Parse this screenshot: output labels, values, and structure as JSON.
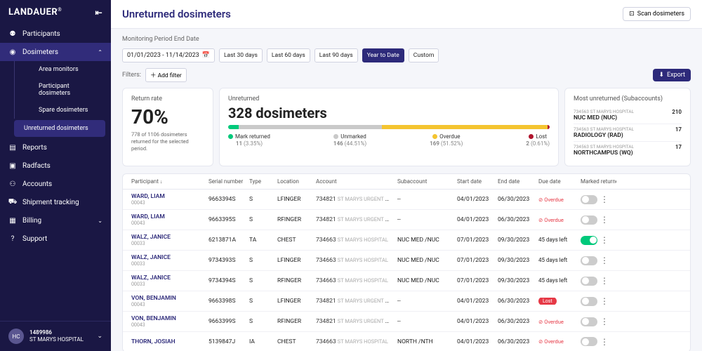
{
  "brand": "LANDAUER",
  "brand_suffix": "®",
  "page_title": "Unreturned dosimeters",
  "scan_label": "Scan dosimeters",
  "sidebar": {
    "items": [
      {
        "icon": "users",
        "label": "Participants"
      },
      {
        "icon": "dosimeter",
        "label": "Dosimeters",
        "expanded": true
      },
      {
        "icon": "report",
        "label": "Reports"
      },
      {
        "icon": "radfacts",
        "label": "Radfacts"
      },
      {
        "icon": "accounts",
        "label": "Accounts"
      },
      {
        "icon": "ship",
        "label": "Shipment tracking"
      },
      {
        "icon": "billing",
        "label": "Billing"
      },
      {
        "icon": "support",
        "label": "Support"
      }
    ],
    "sub": [
      "Area monitors",
      "Participant dosimeters",
      "Spare dosimeters",
      "Unreturned dosimeters"
    ]
  },
  "user": {
    "initials": "HC",
    "id": "1489986",
    "org": "ST MARYS HOSPITAL"
  },
  "period": {
    "label": "Monitoring Period End Date",
    "range": "01/01/2023 - 11/14/2023",
    "presets": [
      "Last 30 days",
      "Last 60 days",
      "Last 90 days",
      "Year to Date",
      "Custom"
    ],
    "active": 3
  },
  "filters": {
    "label": "Filters:",
    "add": "Add filter"
  },
  "export_label": "Export",
  "return_rate": {
    "title": "Return rate",
    "pct": "70%",
    "sub": "778 of 1106 dosimeters returned for the selected period."
  },
  "unreturned": {
    "title": "Unreturned",
    "count": "328 dosimeters",
    "segments": [
      {
        "name": "Mark returned",
        "value": "11",
        "pct": "(3.35%)",
        "color": "#00c97b"
      },
      {
        "name": "Unmarked",
        "value": "146",
        "pct": "(44.51%)",
        "color": "#c9c9c9"
      },
      {
        "name": "Overdue",
        "value": "169",
        "pct": "(51.52%)",
        "color": "#f4c430"
      },
      {
        "name": "Lost",
        "value": "2",
        "pct": "(0.61%)",
        "color": "#b0152d"
      }
    ]
  },
  "most": {
    "title": "Most unreturned (Subaccounts)",
    "items": [
      {
        "sub": "734563 ST MARYS HOSPITAL",
        "name": "NUC MED  (NUC)",
        "count": "210"
      },
      {
        "sub": "734563 ST MARYS HOSPITAL",
        "name": "RADIOLOGY  (RAD)",
        "count": "17"
      },
      {
        "sub": "734563 ST MARYS HOSPITAL",
        "name": "NORTHCAMPUS  (WQ)",
        "count": "17"
      }
    ]
  },
  "table": {
    "headers": {
      "participant": "Participant",
      "serial": "Serial number",
      "type": "Type",
      "location": "Location",
      "account": "Account",
      "subaccount": "Subaccount",
      "start": "Start date",
      "end": "End date",
      "due": "Due date",
      "marked": "Marked returned"
    },
    "rows": [
      {
        "name": "WARD, LIAM",
        "pid": "00043",
        "serial": "9663394S",
        "type": "S",
        "loc": "LFINGER",
        "acctId": "734821",
        "acctNm": "ST MARYS URGENT CARE",
        "sub": "--",
        "start": "04/01/2023",
        "end": "06/30/2023",
        "due": "overdue",
        "on": false
      },
      {
        "name": "WARD, LIAM",
        "pid": "00043",
        "serial": "9663395S",
        "type": "S",
        "loc": "RFINGER",
        "acctId": "734821",
        "acctNm": "ST MARYS URGENT CARE",
        "sub": "--",
        "start": "04/01/2023",
        "end": "06/30/2023",
        "due": "overdue",
        "on": false
      },
      {
        "name": "WALZ, JANICE",
        "pid": "00033",
        "serial": "6213871A",
        "type": "TA",
        "loc": "CHEST",
        "acctId": "734663",
        "acctNm": "ST MARYS HOSPITAL",
        "sub": "NUC MED /NUC",
        "start": "07/01/2023",
        "end": "09/30/2023",
        "due": "45 days left",
        "on": true
      },
      {
        "name": "WALZ, JANICE",
        "pid": "00033",
        "serial": "9734393S",
        "type": "S",
        "loc": "LFINGER",
        "acctId": "734663",
        "acctNm": "ST MARYS HOSPITAL",
        "sub": "NUC MED /NUC",
        "start": "07/01/2023",
        "end": "09/30/2023",
        "due": "45 days left",
        "on": false
      },
      {
        "name": "WALZ, JANICE",
        "pid": "00033",
        "serial": "9734394S",
        "type": "S",
        "loc": "RFINGER",
        "acctId": "734663",
        "acctNm": "ST MARYS HOSPITAL",
        "sub": "NUC MED /NUC",
        "start": "07/01/2023",
        "end": "09/30/2023",
        "due": "45 days left",
        "on": false
      },
      {
        "name": "VON, BENJAMIN",
        "pid": "00043",
        "serial": "9663398S",
        "type": "S",
        "loc": "LFINGER",
        "acctId": "734821",
        "acctNm": "ST MARYS URGENT CARE",
        "sub": "--",
        "start": "04/01/2023",
        "end": "06/30/2023",
        "due": "overdue",
        "lost": true,
        "on": false
      },
      {
        "name": "VON, BENJAMIN",
        "pid": "00043",
        "serial": "9663399S",
        "type": "S",
        "loc": "RFINGER",
        "acctId": "734821",
        "acctNm": "ST MARYS URGENT CARE",
        "sub": "--",
        "start": "04/01/2023",
        "end": "06/30/2023",
        "due": "overdue",
        "on": false
      },
      {
        "name": "THORN, JOSIAH",
        "pid": "",
        "serial": "5139847J",
        "type": "IA",
        "loc": "CHEST",
        "acctId": "734663",
        "acctNm": "ST MARYS HOSPITAL",
        "sub": "NORTH /NTH",
        "start": "04/01/2023",
        "end": "06/30/2023",
        "due": "overdue",
        "on": false
      }
    ],
    "overdue_text": "Overdue",
    "lost_text": "Lost"
  }
}
